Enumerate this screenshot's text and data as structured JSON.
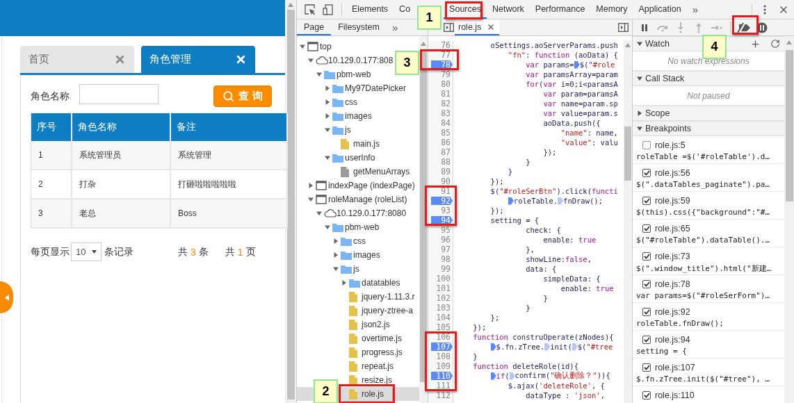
{
  "app": {
    "tabs": [
      {
        "label": "首页",
        "selected": false
      },
      {
        "label": "角色管理",
        "selected": true
      }
    ],
    "search": {
      "label": "角色名称",
      "button": "查 询"
    },
    "table": {
      "columns": [
        "序号",
        "角色名称",
        "备注"
      ],
      "rows": [
        [
          "1",
          "系统管理员",
          "系统管理"
        ],
        [
          "2",
          "打杂",
          "打砸啦啦啦啦啦"
        ],
        [
          "3",
          "老总",
          "Boss"
        ]
      ]
    },
    "pagination": {
      "label_before": "每页显示",
      "page_size": "10",
      "label_after": "条记录",
      "total_prefix": "共",
      "total_count": "3",
      "total_suffix": "条",
      "pages_prefix": "共",
      "pages_count": "1",
      "pages_suffix": "页"
    }
  },
  "devtools": {
    "tabs": [
      {
        "label": "Elements",
        "selected": false
      },
      {
        "label": "Co",
        "selected": false
      },
      {
        "label": "Sources",
        "selected": true
      },
      {
        "label": "Network",
        "selected": false
      },
      {
        "label": "Performance",
        "selected": false
      },
      {
        "label": "Memory",
        "selected": false
      },
      {
        "label": "Application",
        "selected": false
      }
    ],
    "more_tabs": "»",
    "navigator": {
      "tabs": [
        {
          "label": "Page",
          "selected": true
        },
        {
          "label": "Filesystem",
          "selected": false
        }
      ],
      "more_tabs": "»",
      "tree": [
        {
          "label": "top",
          "kind": "frame",
          "expanded": true,
          "selected": false,
          "children": [
            {
              "label": "10.129.0.177:808",
              "kind": "origin",
              "expanded": true,
              "selected": false,
              "children": [
                {
                  "label": "pbm-web",
                  "kind": "folder",
                  "expanded": true,
                  "selected": false,
                  "children": [
                    {
                      "label": "My97DatePicker",
                      "kind": "folder",
                      "expanded": false,
                      "selected": false
                    },
                    {
                      "label": "css",
                      "kind": "folder",
                      "expanded": false,
                      "selected": false
                    },
                    {
                      "label": "images",
                      "kind": "folder",
                      "expanded": false,
                      "selected": false
                    },
                    {
                      "label": "js",
                      "kind": "folder",
                      "expanded": true,
                      "selected": false,
                      "children": [
                        {
                          "label": "main.js",
                          "kind": "script",
                          "selected": false
                        }
                      ]
                    },
                    {
                      "label": "userInfo",
                      "kind": "folder",
                      "expanded": true,
                      "selected": false,
                      "children": [
                        {
                          "label": "getMenuArrays",
                          "kind": "document",
                          "selected": false
                        }
                      ]
                    }
                  ]
                }
              ]
            },
            {
              "label": "indexPage (indexPage)",
              "kind": "frame",
              "expanded": false,
              "selected": false
            },
            {
              "label": "roleManage (roleList)",
              "kind": "frame",
              "expanded": true,
              "selected": false,
              "children": [
                {
                  "label": "10.129.0.177:8080",
                  "kind": "origin",
                  "expanded": true,
                  "selected": false,
                  "children": [
                    {
                      "label": "pbm-web",
                      "kind": "folder",
                      "expanded": true,
                      "selected": false,
                      "children": [
                        {
                          "label": "css",
                          "kind": "folder",
                          "expanded": false,
                          "selected": false
                        },
                        {
                          "label": "images",
                          "kind": "folder",
                          "expanded": false,
                          "selected": false
                        },
                        {
                          "label": "js",
                          "kind": "folder",
                          "expanded": true,
                          "selected": false,
                          "children": [
                            {
                              "label": "datatables",
                              "kind": "folder",
                              "expanded": false,
                              "selected": false
                            },
                            {
                              "label": "jquery-1.11.3.r",
                              "kind": "script",
                              "selected": false
                            },
                            {
                              "label": "jquery-ztree-a",
                              "kind": "script",
                              "selected": false
                            },
                            {
                              "label": "json2.js",
                              "kind": "script",
                              "selected": false
                            },
                            {
                              "label": "overtime.js",
                              "kind": "script",
                              "selected": false
                            },
                            {
                              "label": "progress.js",
                              "kind": "script",
                              "selected": false
                            },
                            {
                              "label": "repeat.js",
                              "kind": "script",
                              "selected": false
                            },
                            {
                              "label": "resize.js",
                              "kind": "script",
                              "selected": false
                            },
                            {
                              "label": "role.js",
                              "kind": "script",
                              "selected": true,
                              "highlighted": true
                            }
                          ]
                        }
                      ]
                    }
                  ]
                }
              ]
            }
          ]
        }
      ]
    },
    "editor": {
      "file_tab": "role.js",
      "lines": [
        {
          "n": "76",
          "bp": false,
          "code": [
            {
              "t": "        oSettings.aoServerParams.push"
            }
          ]
        },
        {
          "n": "77",
          "bp": false,
          "code": [
            {
              "s": "            \"fn\""
            },
            {
              "t": ": "
            },
            {
              "k": "function"
            },
            {
              "t": " (aoData) {"
            }
          ]
        },
        {
          "n": "78",
          "bp": true,
          "code": [
            {
              "k": "                var"
            },
            {
              "t": " params="
            },
            {
              "t": "$(",
              "m": true
            },
            {
              "s": "\"#role"
            }
          ]
        },
        {
          "n": "79",
          "bp": false,
          "code": [
            {
              "k": "                var"
            },
            {
              "t": " paramsArray=param"
            }
          ]
        },
        {
          "n": "80",
          "bp": false,
          "code": [
            {
              "k": "                for"
            },
            {
              "t": "("
            },
            {
              "k": "var"
            },
            {
              "t": " i=0;i<paramsA"
            }
          ]
        },
        {
          "n": "81",
          "bp": false,
          "code": [
            {
              "k": "                    var"
            },
            {
              "t": " param=paramsA"
            }
          ]
        },
        {
          "n": "82",
          "bp": false,
          "code": [
            {
              "k": "                    var"
            },
            {
              "t": " name=param.sp"
            }
          ]
        },
        {
          "n": "83",
          "bp": false,
          "code": [
            {
              "k": "                    var"
            },
            {
              "t": " value=param.s"
            }
          ]
        },
        {
          "n": "84",
          "bp": false,
          "code": [
            {
              "t": "                    aoData.push({"
            }
          ]
        },
        {
          "n": "85",
          "bp": false,
          "code": [
            {
              "s": "                        \"name\""
            },
            {
              "t": ": name,"
            }
          ]
        },
        {
          "n": "86",
          "bp": false,
          "code": [
            {
              "s": "                        \"value\""
            },
            {
              "t": ": valu"
            }
          ]
        },
        {
          "n": "87",
          "bp": false,
          "code": [
            {
              "t": "                    });"
            }
          ]
        },
        {
          "n": "88",
          "bp": false,
          "code": [
            {
              "t": "                }"
            }
          ]
        },
        {
          "n": "89",
          "bp": false,
          "code": [
            {
              "t": "            }"
            }
          ]
        },
        {
          "n": "90",
          "bp": false,
          "code": [
            {
              "t": "        });"
            }
          ]
        },
        {
          "n": "91",
          "bp": false,
          "code": [
            {
              "t": "        $("
            },
            {
              "s": "\"#roleSerBtn\""
            },
            {
              "t": ").click("
            },
            {
              "k": "functi"
            }
          ]
        },
        {
          "n": "92",
          "bp": true,
          "code": [
            {
              "t": "            roleTable.",
              "m": true
            },
            {
              "t": "fnDraw();",
              "m": false
            }
          ]
        },
        {
          "n": "93",
          "bp": false,
          "code": [
            {
              "t": "        });"
            }
          ]
        },
        {
          "n": "94",
          "bp": true,
          "code": [
            {
              "t": "        setting = {"
            }
          ]
        },
        {
          "n": "95",
          "bp": false,
          "code": [
            {
              "t": "                check: {"
            }
          ]
        },
        {
          "n": "96",
          "bp": false,
          "code": [
            {
              "t": "                    enable: "
            },
            {
              "k": "true"
            }
          ]
        },
        {
          "n": "97",
          "bp": false,
          "code": [
            {
              "t": "                },"
            }
          ]
        },
        {
          "n": "98",
          "bp": false,
          "code": [
            {
              "t": "                showLine:"
            },
            {
              "k": "false"
            },
            {
              "t": ","
            }
          ]
        },
        {
          "n": "99",
          "bp": false,
          "code": [
            {
              "t": "                data: {"
            }
          ]
        },
        {
          "n": "100",
          "bp": false,
          "code": [
            {
              "t": "                    simpleData: {"
            }
          ]
        },
        {
          "n": "101",
          "bp": false,
          "code": [
            {
              "t": "                        enable: "
            },
            {
              "k": "true"
            }
          ]
        },
        {
          "n": "102",
          "bp": false,
          "code": [
            {
              "t": "                    }"
            }
          ]
        },
        {
          "n": "103",
          "bp": false,
          "code": [
            {
              "t": "                }"
            }
          ]
        },
        {
          "n": "104",
          "bp": false,
          "code": [
            {
              "t": "        };"
            }
          ]
        },
        {
          "n": "105",
          "bp": false,
          "code": [
            {
              "t": "    });"
            }
          ]
        },
        {
          "n": "106",
          "bp": false,
          "code": [
            {
              "k": "    function"
            },
            {
              "t": " construOperate(zNodes){"
            }
          ]
        },
        {
          "n": "107",
          "bp": true,
          "code": [
            {
              "t": "        $.fn.zTree.",
              "m": true
            },
            {
              "t": "init(",
              "m": false
            },
            {
              "t": "$(",
              "m": false
            },
            {
              "s": "\"#tree"
            }
          ]
        },
        {
          "n": "108",
          "bp": false,
          "code": [
            {
              "t": "    }"
            }
          ]
        },
        {
          "n": "109",
          "bp": false,
          "code": [
            {
              "k": "    function"
            },
            {
              "t": " deleteRole(id){"
            }
          ]
        },
        {
          "n": "110",
          "bp": true,
          "code": [
            {
              "k": "        if",
              "m": true
            },
            {
              "t": "("
            },
            {
              "t": "confirm(",
              "m": false
            },
            {
              "s": "\"确认删除？\""
            },
            {
              "t": ")){"
            }
          ]
        },
        {
          "n": "111",
          "bp": false,
          "code": [
            {
              "t": "            $.ajax("
            },
            {
              "s": "'deleteRole'"
            },
            {
              "t": ", {"
            }
          ]
        },
        {
          "n": "112",
          "bp": false,
          "code": [
            {
              "t": "                dataType : "
            },
            {
              "s": "'json'"
            },
            {
              "t": ","
            }
          ]
        }
      ]
    },
    "debugger": {
      "toolbar": [
        {
          "kind": "pause",
          "disabled": false
        },
        {
          "kind": "step-over",
          "disabled": true
        },
        {
          "kind": "step-into",
          "disabled": true
        },
        {
          "kind": "step-out",
          "disabled": true
        },
        {
          "kind": "step",
          "disabled": true
        },
        {
          "kind": "deactivate",
          "disabled": false
        },
        {
          "kind": "pause-exceptions",
          "disabled": false
        }
      ],
      "sections": [
        {
          "kind": "watch",
          "title": "Watch",
          "expanded": true,
          "placeholder": "No watch expressions"
        },
        {
          "kind": "callstack",
          "title": "Call Stack",
          "expanded": true,
          "placeholder": "Not paused"
        },
        {
          "kind": "scope",
          "title": "Scope",
          "expanded": false
        },
        {
          "kind": "breakpoints",
          "title": "Breakpoints",
          "expanded": true
        }
      ],
      "breakpoints": [
        {
          "location": "role.js:5",
          "checked": false,
          "snippet": "roleTable =$('#roleTable').d…"
        },
        {
          "location": "role.js:56",
          "checked": true,
          "snippet": "$(\".dataTables_paginate\").pa…"
        },
        {
          "location": "role.js:59",
          "checked": true,
          "snippet": "$(this).css({\"background\":\"#…"
        },
        {
          "location": "role.js:65",
          "checked": true,
          "snippet": "$(\"#roleTable\").dataTable().…"
        },
        {
          "location": "role.js:73",
          "checked": true,
          "snippet": "$(\".window_title\").html(\"新建…"
        },
        {
          "location": "role.js:78",
          "checked": true,
          "snippet": "var params=$(\"#roleSerForm\")…"
        },
        {
          "location": "role.js:92",
          "checked": true,
          "snippet": "roleTable.fnDraw();"
        },
        {
          "location": "role.js:94",
          "checked": true,
          "snippet": "setting = {"
        },
        {
          "location": "role.js:107",
          "checked": true,
          "snippet": "$.fn.zTree.init($(\"#tree\"), …"
        },
        {
          "location": "role.js:110",
          "checked": true
        }
      ]
    }
  },
  "callouts": [
    "1",
    "2",
    "3",
    "4"
  ]
}
